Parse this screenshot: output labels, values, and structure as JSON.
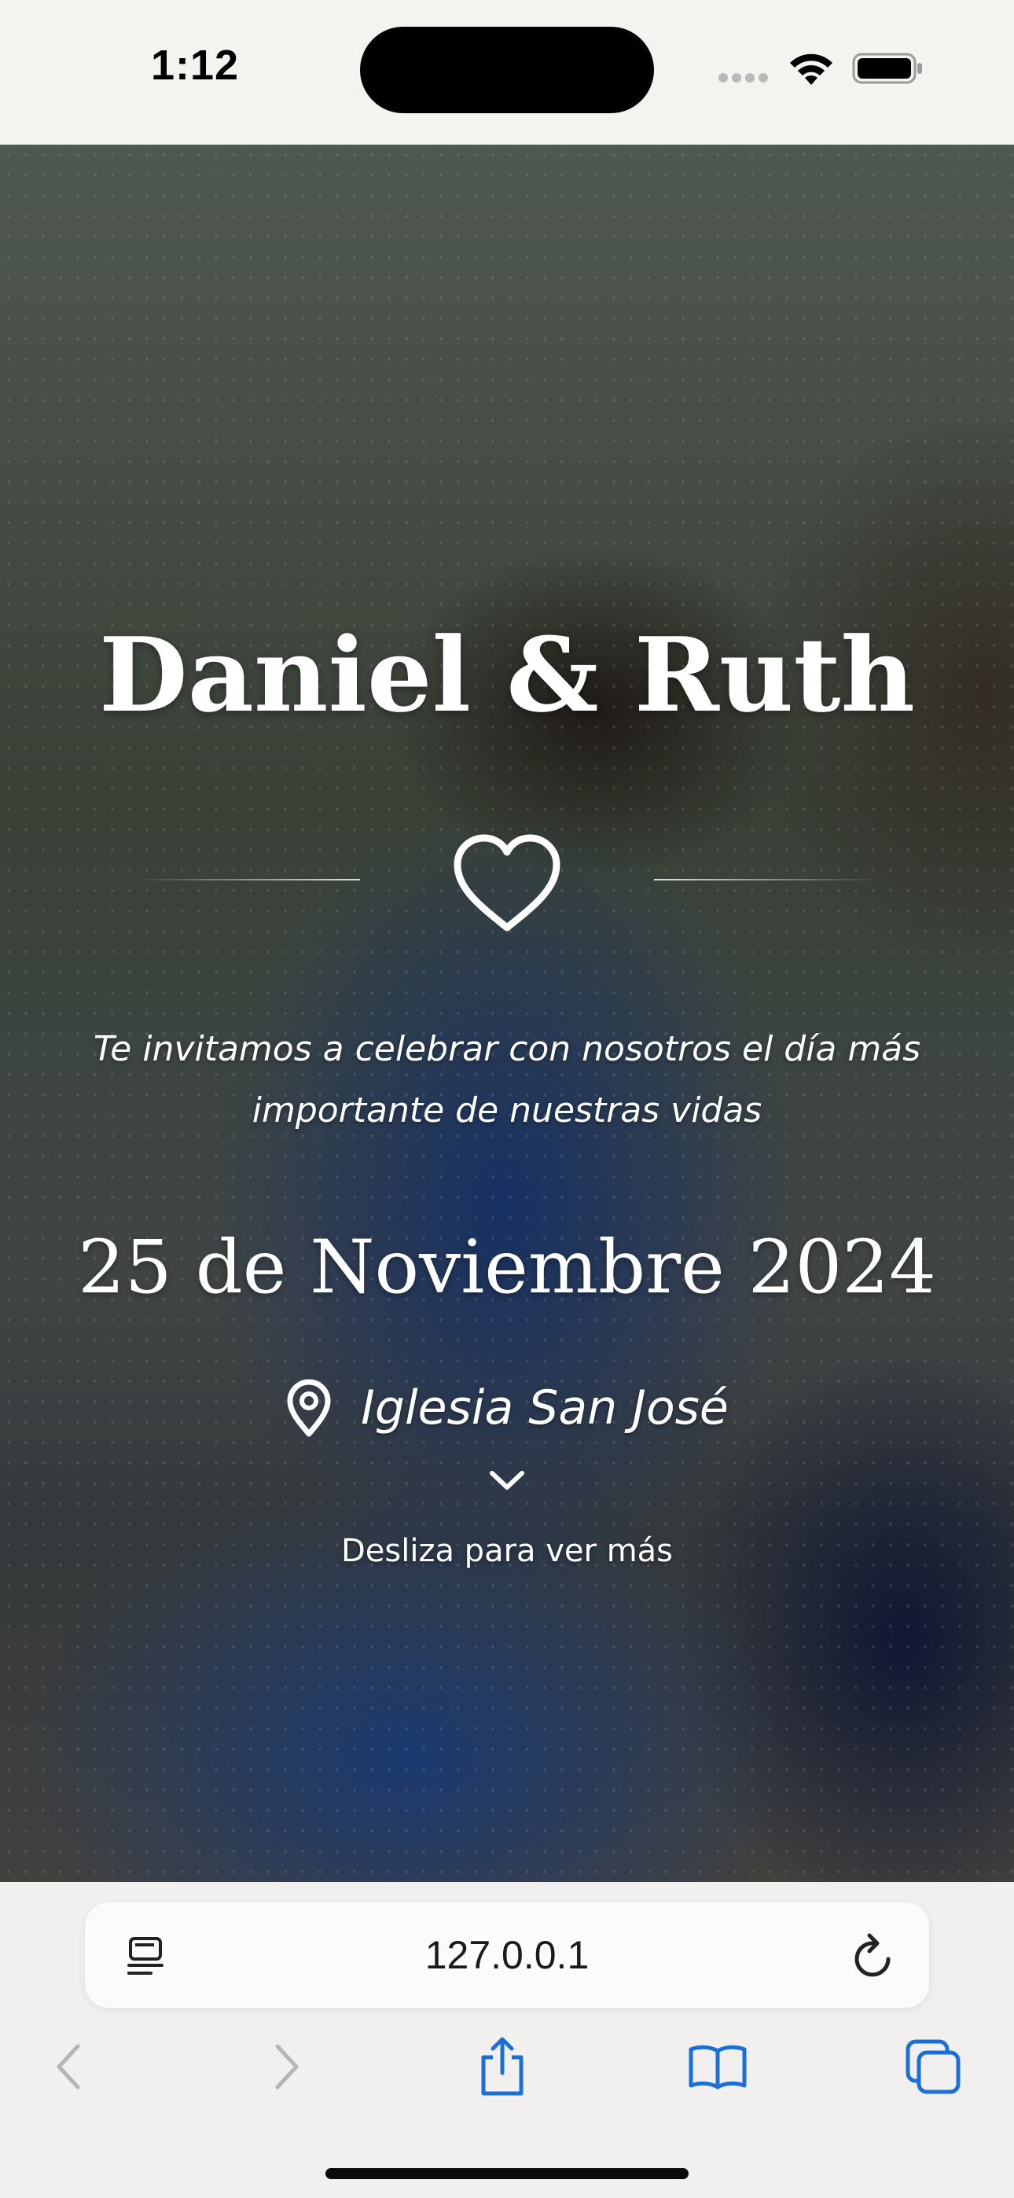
{
  "status_bar": {
    "time": "1:12"
  },
  "hero": {
    "names": "Daniel & Ruth",
    "invitation": "Te invitamos a celebrar con nosotros el día más importante de nuestras vidas",
    "date": "25 de Noviembre 2024",
    "venue": "Iglesia San José",
    "scroll_hint": "Desliza para ver más"
  },
  "browser": {
    "url": "127.0.0.1"
  },
  "icons": {
    "heart": "heart-icon",
    "pin": "location-pin-icon",
    "chevron": "chevron-down-icon",
    "reader": "reader-mode-icon",
    "reload": "reload-icon",
    "back": "back-arrow-icon",
    "forward": "forward-arrow-icon",
    "share": "share-icon",
    "bookmarks": "bookmarks-icon",
    "tabs": "tabs-icon"
  },
  "colors": {
    "accent": "#1a6fd8",
    "dress_blue": "#1c4c9c",
    "text_light": "#ffffff"
  }
}
